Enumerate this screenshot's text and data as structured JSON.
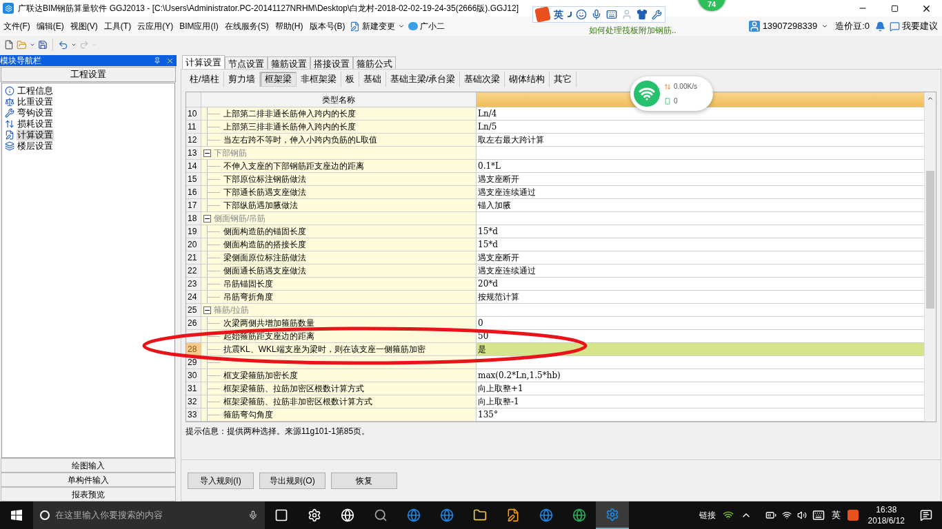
{
  "window": {
    "title": "广联达BIM钢筋算量软件 GGJ2013 - [C:\\Users\\Administrator.PC-20141127NRHM\\Desktop\\白龙村-2018-02-02-19-24-35(2666版).GGJ12]",
    "badge": "74"
  },
  "ime_bar": {
    "mode": "英"
  },
  "menu": [
    "文件(F)",
    "编辑(E)",
    "视图(V)",
    "工具(T)",
    "云应用(Y)",
    "BIM应用(I)",
    "在线服务(S)",
    "帮助(H)",
    "版本号(B)"
  ],
  "menu_extra": {
    "change": "新建变更",
    "assistant": "广小二",
    "news": "如何处理筏板附加钢筋..",
    "account": "13907298339",
    "beans": "造价豆:0",
    "feedback": "我要建议"
  },
  "nav": {
    "title": "模块导航栏",
    "section": "工程设置",
    "items": [
      {
        "label": "工程信息",
        "selected": false
      },
      {
        "label": "比重设置",
        "selected": false
      },
      {
        "label": "弯钩设置",
        "selected": false
      },
      {
        "label": "损耗设置",
        "selected": false
      },
      {
        "label": "计算设置",
        "selected": true
      },
      {
        "label": "楼层设置",
        "selected": false
      }
    ],
    "bottom": [
      "绘图输入",
      "单构件输入",
      "报表预览"
    ]
  },
  "tabs": [
    {
      "label": "计算设置",
      "selected": true
    },
    {
      "label": "节点设置",
      "selected": false
    },
    {
      "label": "箍筋设置",
      "selected": false
    },
    {
      "label": "搭接设置",
      "selected": false
    },
    {
      "label": "箍筋公式",
      "selected": false
    }
  ],
  "subtabs": [
    {
      "label": "柱/墙柱",
      "selected": false
    },
    {
      "label": "剪力墙",
      "selected": false
    },
    {
      "label": "框架梁",
      "selected": true
    },
    {
      "label": "非框架梁",
      "selected": false
    },
    {
      "label": "板",
      "selected": false
    },
    {
      "label": "基础",
      "selected": false
    },
    {
      "label": "基础主梁/承台梁",
      "selected": false
    },
    {
      "label": "基础次梁",
      "selected": false
    },
    {
      "label": "砌体结构",
      "selected": false
    },
    {
      "label": "其它",
      "selected": false
    }
  ],
  "network_widget": {
    "speed": "0.00K/s",
    "count": "0"
  },
  "table": {
    "columns": [
      "类型名称"
    ],
    "rows": [
      {
        "num": "10",
        "label": "上部第二排非通长筋伸入跨内的长度",
        "value": "Ln/4",
        "selected": false
      },
      {
        "num": "11",
        "label": "上部第三排非通长筋伸入跨内的长度",
        "value": "Ln/5",
        "selected": false
      },
      {
        "num": "12",
        "label": "当左右跨不等时，伸入小跨内负筋的L取值",
        "value": "取左右最大跨计算",
        "selected": false
      },
      {
        "num": "13",
        "label": "下部钢筋",
        "expanded": true,
        "children": [
          {
            "num": "14",
            "label": "不伸入支座的下部钢筋距支座边的距离",
            "value": "0.1*L",
            "selected": false
          },
          {
            "num": "15",
            "label": "下部原位标注钢筋做法",
            "value": "遇支座断开",
            "selected": false
          },
          {
            "num": "16",
            "label": "下部通长筋遇支座做法",
            "value": "遇支座连续通过",
            "selected": false
          },
          {
            "num": "17",
            "label": "下部纵筋遇加腋做法",
            "value": "锚入加腋",
            "selected": false
          }
        ]
      },
      {
        "num": "18",
        "label": "侧面钢筋/吊筋",
        "expanded": true,
        "children": [
          {
            "num": "19",
            "label": "侧面构造筋的锚固长度",
            "value": "15*d",
            "selected": false
          },
          {
            "num": "20",
            "label": "侧面构造筋的搭接长度",
            "value": "15*d",
            "selected": false
          },
          {
            "num": "21",
            "label": "梁侧面原位标注筋做法",
            "value": "遇支座断开",
            "selected": false
          },
          {
            "num": "22",
            "label": "侧面通长筋遇支座做法",
            "value": "遇支座连续通过",
            "selected": false
          },
          {
            "num": "23",
            "label": "吊筋锚固长度",
            "value": "20*d",
            "selected": false
          },
          {
            "num": "24",
            "label": "吊筋弯折角度",
            "value": "按规范计算",
            "selected": false
          }
        ]
      },
      {
        "num": "25",
        "label": "箍筋/拉筋",
        "expanded": true,
        "children": [
          {
            "num": "26",
            "label": "次梁两侧共增加箍筋数量",
            "value": "0",
            "selected": false
          },
          {
            "label": "起始箍筋距支座边的距离",
            "value": "50",
            "selected": false
          },
          {
            "num": "28",
            "label": "抗震KL、WKL端支座为梁时，则在该支座一侧箍筋加密",
            "value": "是",
            "selected": true
          },
          {
            "num": "29",
            "selected": false
          },
          {
            "num": "30",
            "label": "框支梁箍筋加密长度",
            "value": "max(0.2*Ln,1.5*hb)",
            "selected": false
          },
          {
            "num": "31",
            "label": "框架梁箍筋、拉筋加密区根数计算方式",
            "value": "向上取整+1",
            "selected": false
          },
          {
            "num": "32",
            "label": "框架梁箍筋、拉筋非加密区根数计算方式",
            "value": "向上取整-1",
            "selected": false
          },
          {
            "num": "33",
            "label": "箍筋弯勾角度",
            "value": "135°",
            "selected": false
          }
        ]
      }
    ]
  },
  "hint": "提示信息：提供两种选择。来源11g101-1第85页。",
  "buttons": [
    "导入规则(I)",
    "导出规则(O)",
    "恢复"
  ],
  "taskbar": {
    "search_placeholder": "在这里输入你要搜索的内容",
    "link": "链接",
    "ime": "英",
    "time": "16:38",
    "date": "2018/6/12"
  }
}
